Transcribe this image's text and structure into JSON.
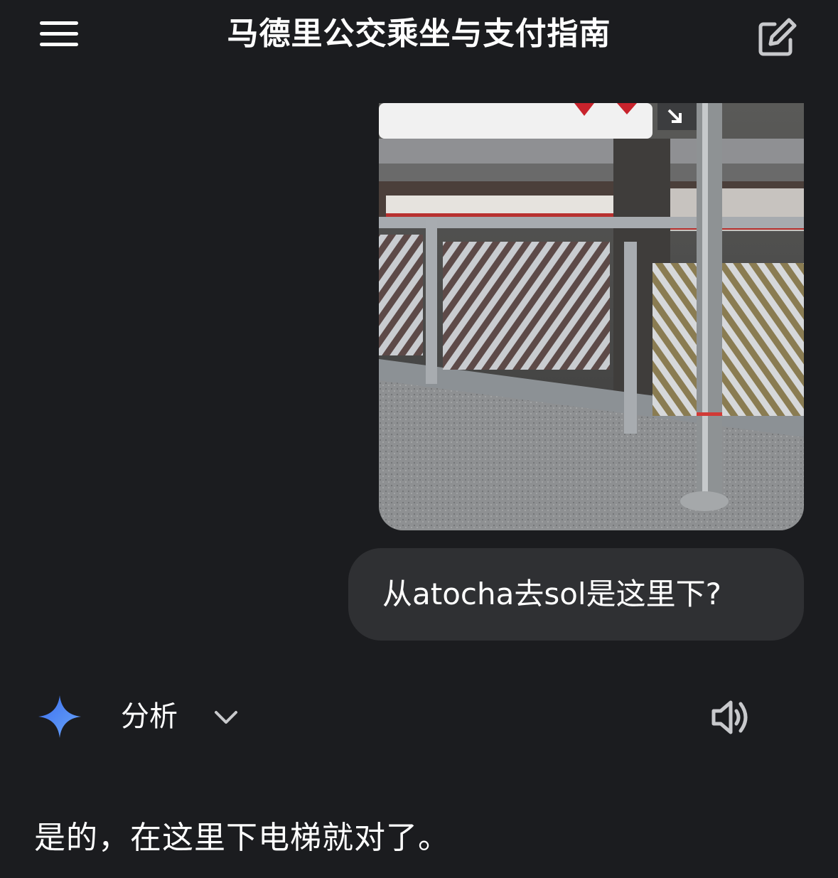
{
  "header": {
    "title": "马德里公交乘坐与支付指南",
    "menu_icon": "hamburger-menu-icon",
    "edit_icon": "edit-pencil-icon"
  },
  "conversation": {
    "user_message": "从atocha去sol是这里下?",
    "assistant": {
      "analysis_label": "分析",
      "answer": "是的，在这里下电梯就对了。"
    }
  },
  "colors": {
    "background": "#1b1c1f",
    "bubble": "#2f3033",
    "accent_spark": "#4a86f5"
  }
}
